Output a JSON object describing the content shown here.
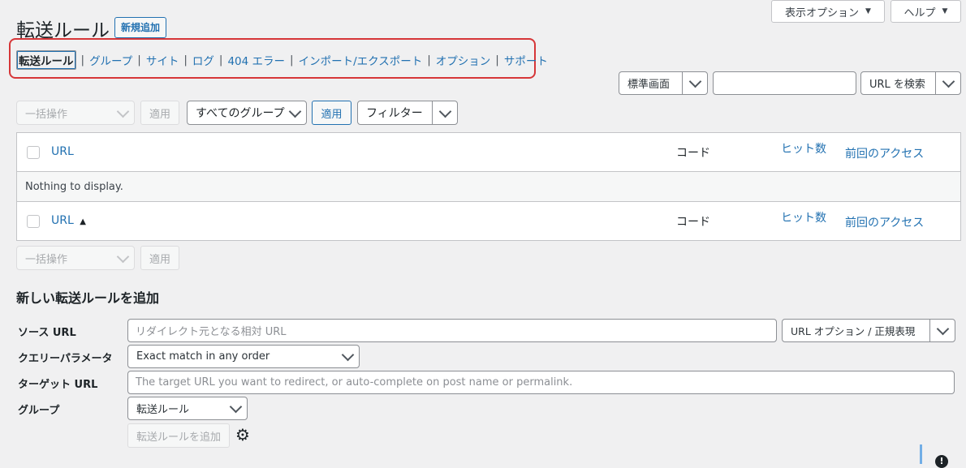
{
  "screen_meta": {
    "display_options": "表示オプション",
    "help": "ヘルプ"
  },
  "header": {
    "title": "転送ルール",
    "add_new": "新規追加"
  },
  "subnav": [
    "転送ルール",
    "グループ",
    "サイト",
    "ログ",
    "404 エラー",
    "インポート/エクスポート",
    "オプション",
    "サポート"
  ],
  "search": {
    "view_select": "標準画面",
    "search_value": "",
    "search_button": "URL を検索"
  },
  "tablenav_top": {
    "bulk_action": "一括操作",
    "apply": "適用",
    "group_filter": "すべてのグループ",
    "apply2": "適用",
    "filter": "フィルター"
  },
  "table": {
    "headers": {
      "url": "URL",
      "code": "コード",
      "hits": "ヒット数",
      "last_access": "前回のアクセス"
    },
    "empty_message": "Nothing to display.",
    "footer_sort_arrow": "▲"
  },
  "tablenav_bottom": {
    "bulk_action": "一括操作",
    "apply": "適用"
  },
  "add_form": {
    "heading": "新しい転送ルールを追加",
    "source_label": "ソース URL",
    "source_placeholder": "リダイレクト元となる相対 URL",
    "url_options": "URL オプション / 正規表現",
    "query_label": "クエリーパラメータ",
    "query_value": "Exact match in any order",
    "target_label": "ターゲット URL",
    "target_placeholder": "The target URL you want to redirect, or auto-complete on post name or permalink.",
    "group_label": "グループ",
    "group_value": "転送ルール",
    "submit": "転送ルールを追加"
  },
  "highlight_color": "#d63638",
  "accent_color": "#2271b1"
}
